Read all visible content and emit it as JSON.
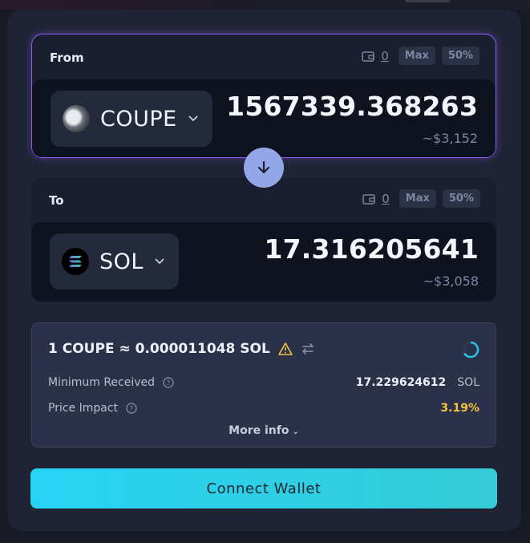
{
  "from": {
    "label": "From",
    "balance": "0",
    "max_label": "Max",
    "half_label": "50%",
    "token": {
      "symbol": "COUPE",
      "icon": "coupe-token-icon"
    },
    "amount": "1567339.368263",
    "usd": "~$3,152"
  },
  "to": {
    "label": "To",
    "balance": "0",
    "max_label": "Max",
    "half_label": "50%",
    "token": {
      "symbol": "SOL",
      "icon": "sol-token-icon"
    },
    "amount": "17.316205641",
    "usd": "~$3,058"
  },
  "info": {
    "rate": "1 COUPE ≈ 0.000011048 SOL",
    "minimum_received_label": "Minimum Received",
    "minimum_received_value": "17.229624612",
    "minimum_received_unit": "SOL",
    "price_impact_label": "Price Impact",
    "price_impact_value": "3.19%",
    "more_info_label": "More info"
  },
  "connect_label": "Connect Wallet",
  "colors": {
    "accent_border": "#8b5cf6",
    "swap_button": "#93a7e8",
    "warning": "#f5c342",
    "connect_start": "#26d3f4",
    "connect_end": "#36cbd6"
  }
}
